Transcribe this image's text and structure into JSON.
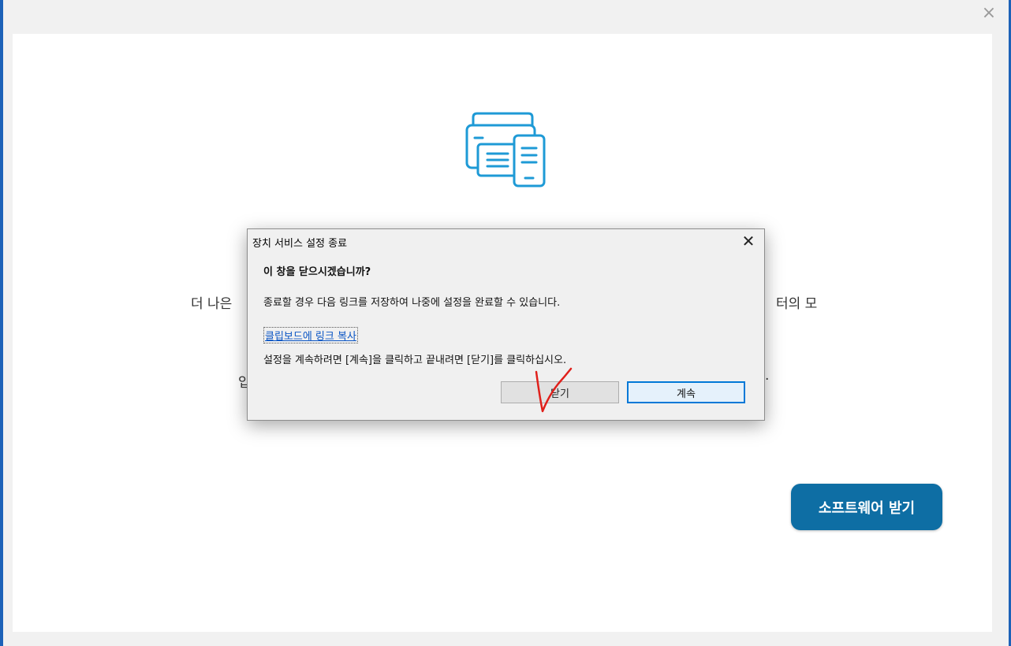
{
  "background": {
    "text_left": "더 나은",
    "text_right": "터의 모",
    "text_left2": "입",
    "text_right2": ".",
    "get_software_label": "소프트웨어 받기",
    "close_glyph": "×"
  },
  "dialog": {
    "title": "장치 서비스 설정 종료",
    "close_glyph": "✕",
    "heading": "이 창을 닫으시겠습니까?",
    "message": "종료할 경우 다음 링크를 저장하여 나중에 설정을 완료할 수 있습니다.",
    "copy_link_label": "클립보드에 링크 복사",
    "instruction": "설정을 계속하려면 [계속]을 클릭하고 끝내려면 [닫기]를 클릭하십시오.",
    "close_button_label": "닫기",
    "continue_button_label": "계속"
  },
  "colors": {
    "accent": "#0e6ea4",
    "icon": "#1e9ad6",
    "annotation": "#e0201b",
    "link": "#0a55c4"
  },
  "icons": [
    "printer-phone-icon",
    "close-icon",
    "checkmark-annotation"
  ]
}
